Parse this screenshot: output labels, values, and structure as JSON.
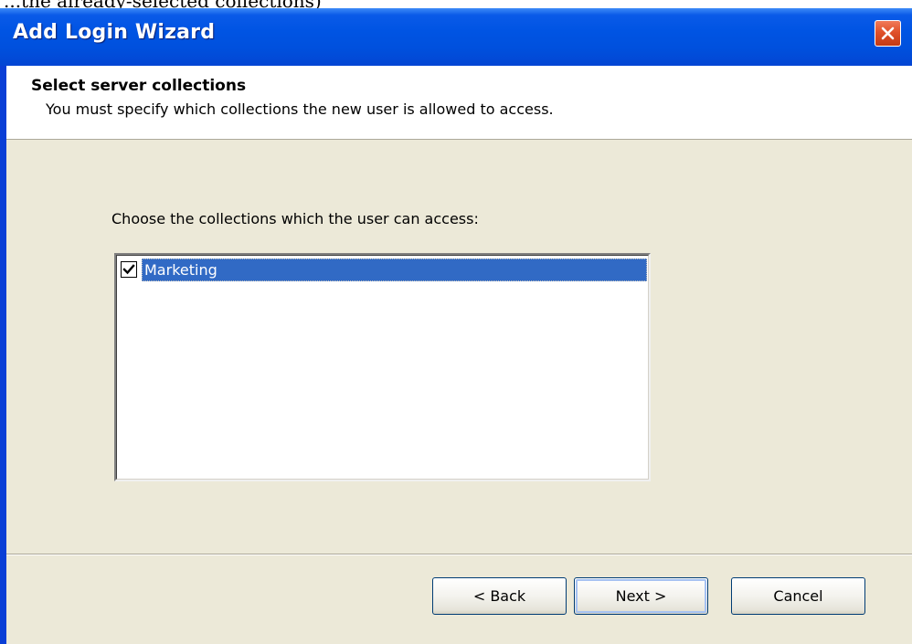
{
  "doc_fragment_text": "...the already-selected collections)",
  "window": {
    "title": "Add Login Wizard"
  },
  "header": {
    "title": "Select server collections",
    "subtitle": "You must specify which collections the new user is allowed to access."
  },
  "main": {
    "prompt": "Choose the collections which the user can access:",
    "collections": [
      {
        "label": "Marketing",
        "checked": true,
        "selected": true
      }
    ]
  },
  "buttons": {
    "back_label": "< Back",
    "next_label": "Next >",
    "cancel_label": "Cancel"
  },
  "colors": {
    "titlebar": "#0054e3",
    "selection": "#316ac5",
    "dialog_bg": "#ece9d8"
  }
}
